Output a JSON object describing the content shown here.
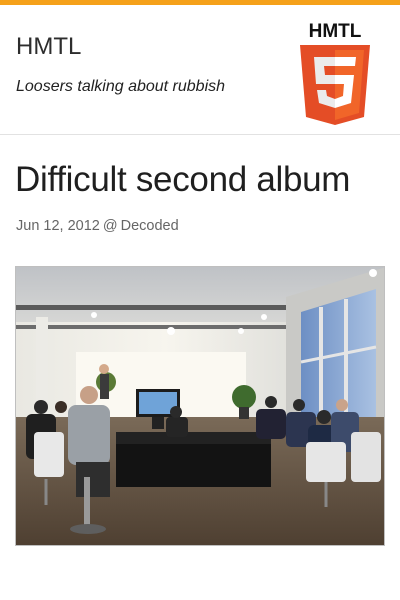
{
  "header": {
    "site_title": "HMTL",
    "tagline": "Loosers talking about rubbish",
    "logo": {
      "text": "HMTL",
      "numeral": "5",
      "shield_color": "#e44d26",
      "shield_highlight": "#f16529"
    }
  },
  "post": {
    "title": "Difficult second album",
    "date": "Jun 12, 2012",
    "at": "@",
    "category": "Decoded",
    "image_description_icon": "photo-presentation"
  },
  "colors": {
    "accent_bar": "#f5a11a",
    "divider": "#e2e2e2",
    "meta_text": "#666666"
  }
}
